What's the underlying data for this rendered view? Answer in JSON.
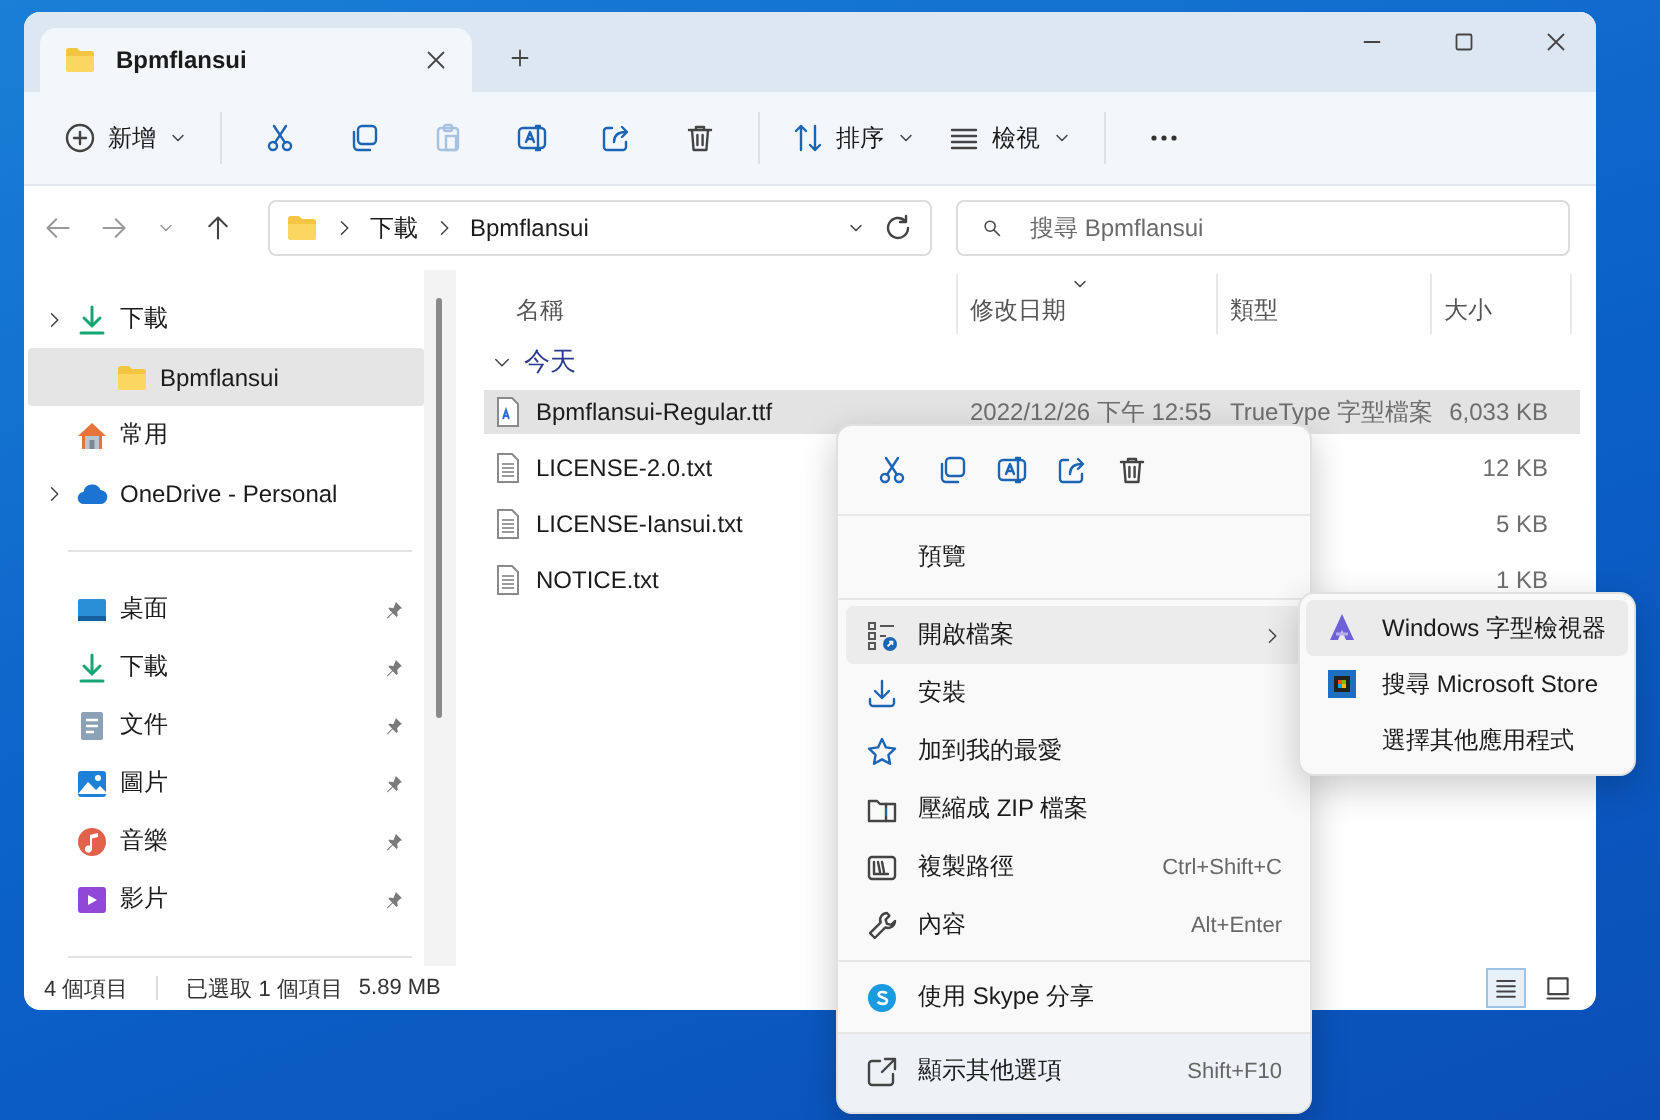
{
  "window": {
    "tab_title": "Bpmflansui"
  },
  "toolbar": {
    "new_label": "新增",
    "actions": [
      {
        "disabled": false
      },
      {
        "disabled": false
      },
      {
        "disabled": true
      },
      {
        "disabled": false
      },
      {
        "disabled": false
      },
      {
        "disabled": false
      }
    ],
    "sort_label": "排序",
    "view_label": "檢視"
  },
  "address": {
    "breadcrumb": [
      "下載",
      "Bpmflansui"
    ],
    "search_placeholder": "搜尋 Bpmflansui"
  },
  "sidebar": {
    "items": [
      {
        "label": "下載",
        "expandable": true,
        "selected": false,
        "children": [
          {
            "label": "Bpmflansui",
            "selected": true
          }
        ]
      },
      {
        "label": "常用",
        "expandable": false,
        "selected": false
      },
      {
        "label": "OneDrive - Personal",
        "expandable": true,
        "selected": false
      }
    ],
    "quick_access": [
      {
        "label": "桌面",
        "pinned": true
      },
      {
        "label": "下載",
        "pinned": true
      },
      {
        "label": "文件",
        "pinned": true
      },
      {
        "label": "圖片",
        "pinned": true
      },
      {
        "label": "音樂",
        "pinned": true
      },
      {
        "label": "影片",
        "pinned": true
      }
    ]
  },
  "files": {
    "columns": [
      {
        "label": "名稱",
        "sorted": false
      },
      {
        "label": "修改日期",
        "sorted": true
      },
      {
        "label": "類型",
        "sorted": false
      },
      {
        "label": "大小",
        "sorted": false
      }
    ],
    "group": {
      "label": "今天",
      "expanded": true
    },
    "rows": [
      {
        "name": "Bpmflansui-Regular.ttf",
        "kind": "font",
        "date": "2022/12/26 下午 12:55",
        "type": "TrueType 字型檔案",
        "size": "6,033 KB",
        "selected": true
      },
      {
        "name": "LICENSE-2.0.txt",
        "kind": "text",
        "size": "12 KB",
        "selected": false
      },
      {
        "name": "LICENSE-Iansui.txt",
        "kind": "text",
        "size": "5 KB",
        "selected": false
      },
      {
        "name": "NOTICE.txt",
        "kind": "text",
        "size": "1 KB",
        "selected": false
      }
    ]
  },
  "status_bar": {
    "item_count": "4 個項目",
    "selection": "已選取 1 個項目",
    "selection_size": "5.89 MB",
    "view_modes": [
      {
        "kind": "details",
        "selected": true
      },
      {
        "kind": "tiles",
        "selected": false
      }
    ]
  },
  "context_menu": {
    "sections": [
      [
        {
          "label": "預覽",
          "submenu": false,
          "selected": false
        }
      ],
      [
        {
          "label": "開啟檔案",
          "submenu": true,
          "selected": true
        },
        {
          "label": "安裝",
          "submenu": false,
          "selected": false
        },
        {
          "label": "加到我的最愛",
          "submenu": false,
          "selected": false
        },
        {
          "label": "壓縮成 ZIP 檔案",
          "submenu": false,
          "selected": false
        },
        {
          "label": "複製路徑",
          "shortcut": "Ctrl+Shift+C",
          "submenu": false,
          "selected": false
        },
        {
          "label": "內容",
          "shortcut": "Alt+Enter",
          "submenu": false,
          "selected": false
        }
      ],
      [
        {
          "label": "使用 Skype 分享",
          "submenu": false,
          "selected": false
        }
      ],
      [
        {
          "label": "顯示其他選項",
          "shortcut": "Shift+F10",
          "submenu": false,
          "selected": false
        }
      ]
    ]
  },
  "submenu": {
    "items": [
      {
        "label": "Windows 字型檢視器",
        "selected": true
      },
      {
        "label": "搜尋 Microsoft Store",
        "selected": false
      },
      {
        "label": "選擇其他應用程式",
        "selected": false
      }
    ]
  }
}
